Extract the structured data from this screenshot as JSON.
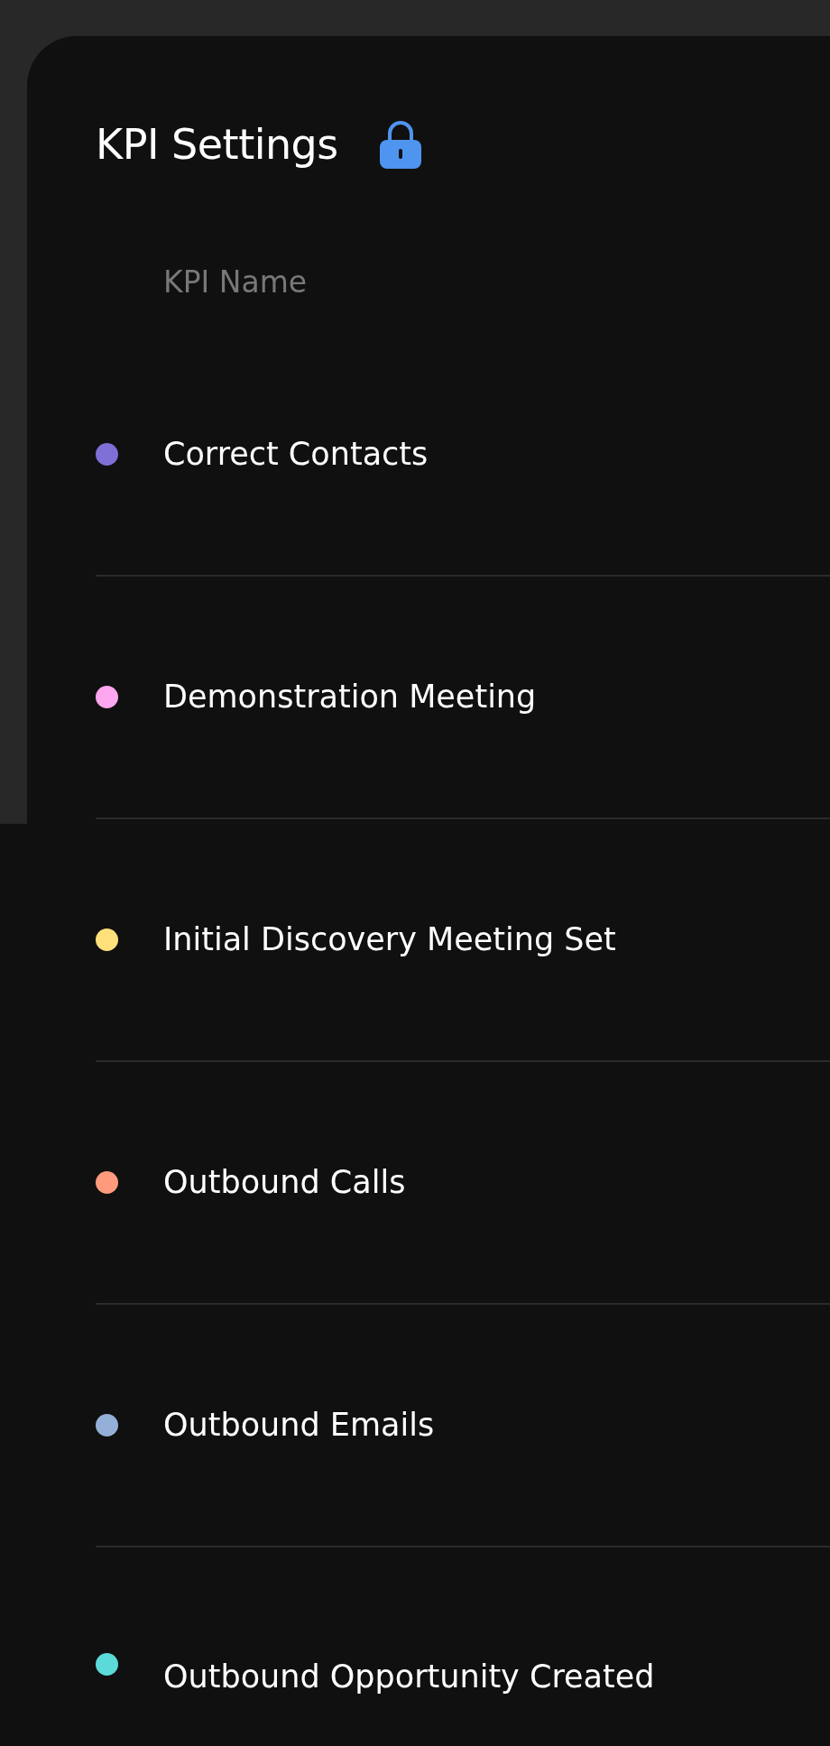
{
  "title": "KPI Settings",
  "table": {
    "columns": [
      "KPI Name"
    ],
    "rows": [
      {
        "name": "Correct Contacts",
        "color": "#7e70d6"
      },
      {
        "name": "Demonstration Meeting",
        "color": "#ffa6f0"
      },
      {
        "name": "Initial Discovery Meeting Set",
        "color": "#ffe07a"
      },
      {
        "name": "Outbound Calls",
        "color": "#ff9a7c"
      },
      {
        "name": "Outbound Emails",
        "color": "#94b0d8"
      },
      {
        "name": "Outbound Opportunity Created",
        "color": "#5cd9d9"
      }
    ]
  }
}
